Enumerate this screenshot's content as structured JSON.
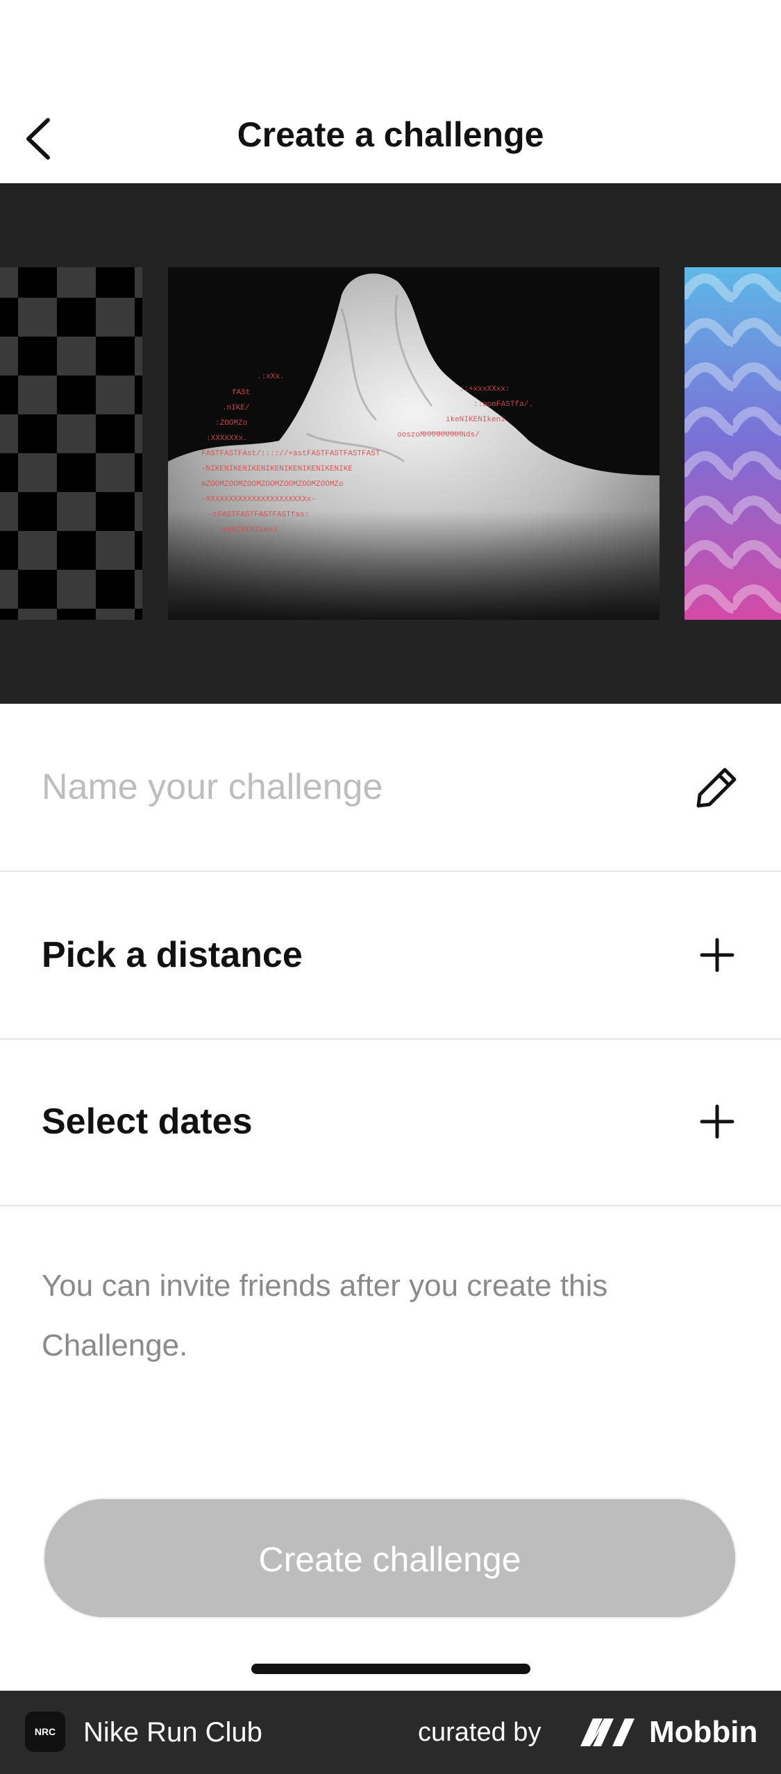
{
  "header": {
    "title": "Create a challenge",
    "back_icon": "chevron-left-icon"
  },
  "carousel": {
    "cards": [
      {
        "name": "checkerboard",
        "colors": [
          "#000000",
          "#3a3a3a"
        ]
      },
      {
        "name": "mountain-ascii",
        "colors": [
          "#0b0b0b",
          "#e6e6e6",
          "#d94b4b"
        ]
      },
      {
        "name": "purple-waves",
        "colors": [
          "#5db8e6",
          "#7b6fd6",
          "#d44aa6"
        ]
      }
    ]
  },
  "form": {
    "name_placeholder": "Name your challenge",
    "name_icon": "pencil-icon",
    "distance_label": "Pick a distance",
    "dates_label": "Select dates",
    "add_icon": "plus-icon"
  },
  "info_text": "You can invite friends after you create this Challenge.",
  "create_button": {
    "label": "Create challenge",
    "bg_color": "#bdbdbd",
    "text_color": "#ffffff"
  },
  "footer": {
    "app_icon_label": "NRC",
    "app_name": "Nike Run Club",
    "curated_label": "curated by",
    "brand_name": "Mobbin"
  }
}
